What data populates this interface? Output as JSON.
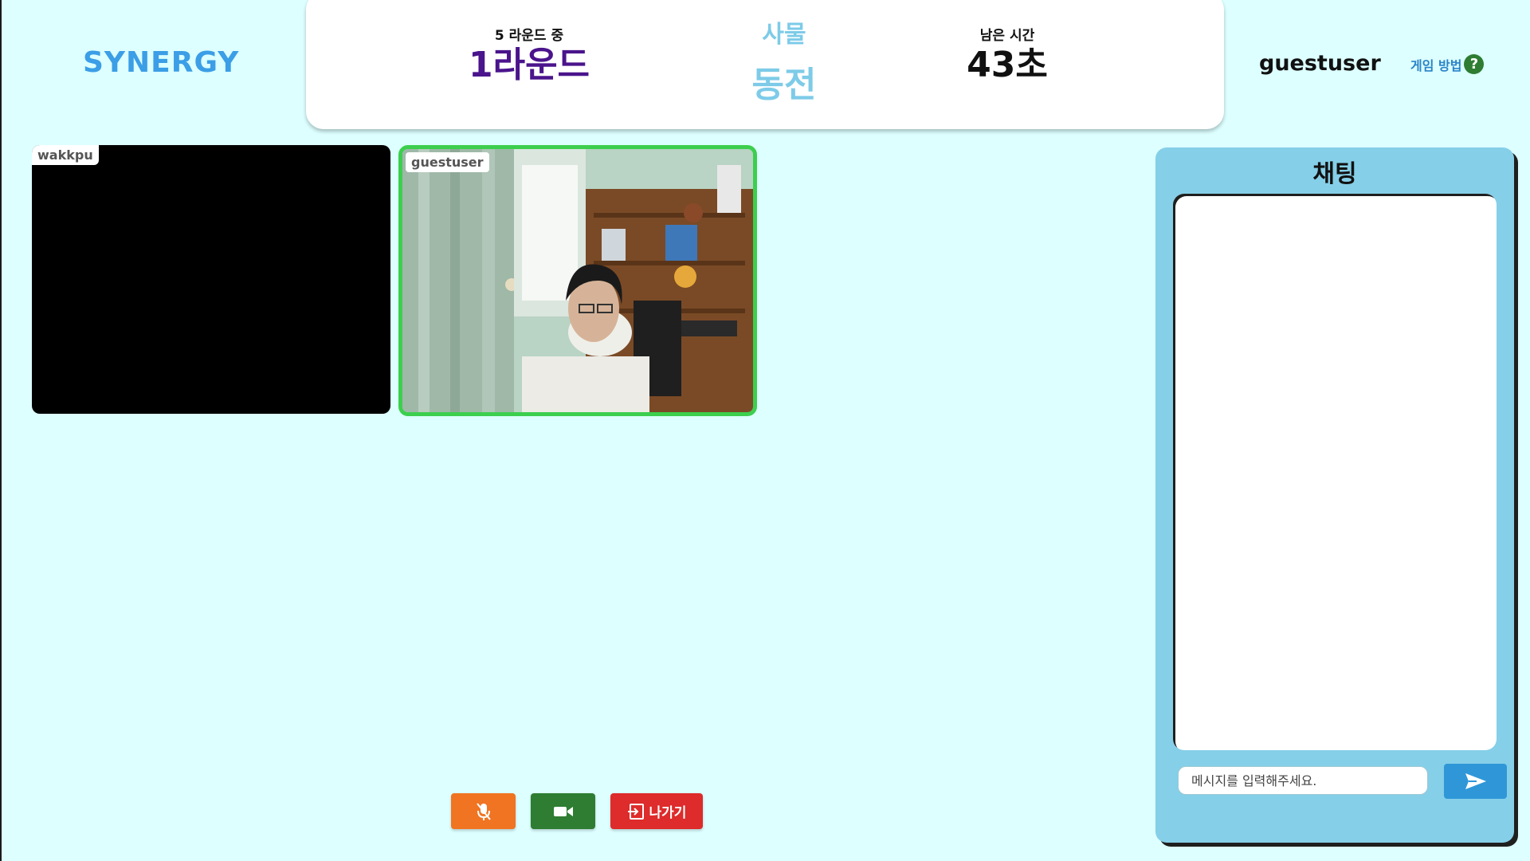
{
  "app": {
    "logo": "SYNERGY"
  },
  "game": {
    "round_sub": "5 라운드 중",
    "round_main": "1라운드",
    "word_category": "사물",
    "word": "동전",
    "time_sub": "남은 시간",
    "time_main": "43초"
  },
  "user": {
    "name": "guestuser",
    "howto_label": "게임 방법",
    "help_icon": "?"
  },
  "participants": [
    {
      "name": "wakkpu",
      "video": "off"
    },
    {
      "name": "guestuser",
      "video": "on",
      "speaking": true
    }
  ],
  "controls": {
    "mic_icon": "mic-muted-icon",
    "camera_icon": "video-camera-icon",
    "exit_label": "나가기"
  },
  "chat": {
    "title": "채팅",
    "placeholder": "메시지를 입력해주세요.",
    "send_icon": "send-icon"
  },
  "colors": {
    "background": "#ddffff",
    "logo": "#3b9ee6",
    "round": "#4a148c",
    "word": "#7dcbe8",
    "active_border": "#3ccf4e",
    "mic": "#f07422",
    "camera": "#2e7d32",
    "exit": "#de2b2b",
    "chat_panel": "#85cfe8",
    "send": "#2f97d8"
  }
}
